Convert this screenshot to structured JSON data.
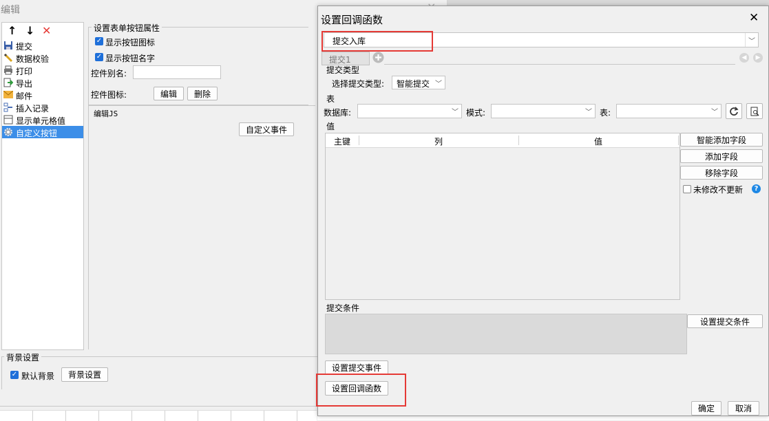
{
  "background": {
    "title": "编辑",
    "close": "×",
    "toolbar": {
      "up": "↑",
      "down": "↓",
      "delete": "✕"
    },
    "list": [
      {
        "label": "提交",
        "icon": "save-icon"
      },
      {
        "label": "数据校验",
        "icon": "pencil-icon"
      },
      {
        "label": "打印",
        "icon": "printer-icon"
      },
      {
        "label": "导出",
        "icon": "export-icon"
      },
      {
        "label": "邮件",
        "icon": "mail-icon"
      },
      {
        "label": "插入记录",
        "icon": "insert-record-icon"
      },
      {
        "label": "显示单元格值",
        "icon": "cell-value-icon"
      },
      {
        "label": "自定义按钮",
        "icon": "gear-icon",
        "selected": true
      }
    ],
    "props": {
      "group_title": "设置表单按钮属性",
      "show_icon": "显示按钮图标",
      "show_name": "显示按钮名字",
      "alias_label": "控件别名:",
      "icon_label": "控件图标:",
      "edit_btn": "编辑",
      "delete_btn": "删除"
    },
    "js": {
      "title": "编辑JS",
      "custom_event": "自定义事件"
    },
    "bg": {
      "group_title": "背景设置",
      "default_bg": "默认背景",
      "bg_btn": "背景设置"
    }
  },
  "dialog": {
    "title": "设置回调函数",
    "close": "✕",
    "callback_select": "提交入库",
    "tab": "提交1",
    "submit_type": {
      "section": "提交类型",
      "label": "选择提交类型:",
      "value": "智能提交"
    },
    "table": {
      "section": "表",
      "db_label": "数据库:",
      "schema_label": "模式:",
      "table_label": "表:"
    },
    "values": {
      "section": "值",
      "columns": [
        "主键",
        "列",
        "值"
      ],
      "btn_smart_add": "智能添加字段",
      "btn_add": "添加字段",
      "btn_remove": "移除字段",
      "no_update": "未修改不更新",
      "help": "?"
    },
    "condition": {
      "section": "提交条件",
      "btn": "设置提交条件"
    },
    "btn_submit_event": "设置提交事件",
    "btn_callback": "设置回调函数",
    "ok": "确定",
    "cancel": "取消"
  },
  "colors": {
    "highlight": "#e53935",
    "selection": "#3c8ee8",
    "check": "#1e6fd9",
    "help": "#1e88e5"
  }
}
